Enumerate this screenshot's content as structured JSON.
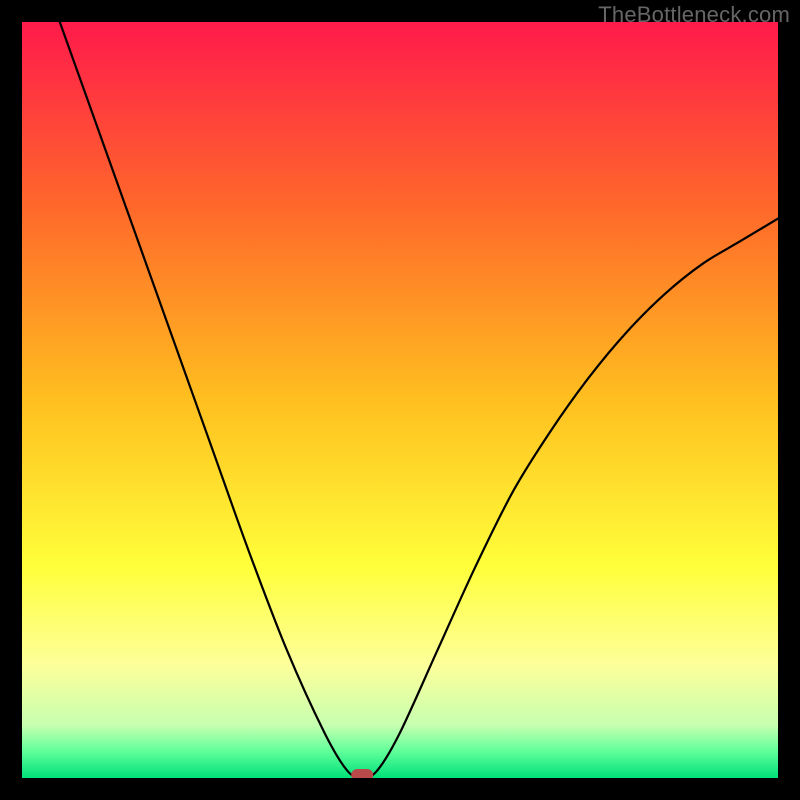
{
  "watermark": "TheBottleneck.com",
  "chart_data": {
    "type": "line",
    "title": "",
    "xlabel": "",
    "ylabel": "",
    "xlim": [
      0,
      100
    ],
    "ylim": [
      0,
      100
    ],
    "series": [
      {
        "name": "bottleneck-curve",
        "x": [
          5,
          10,
          15,
          20,
          25,
          30,
          35,
          40,
          43,
          45,
          47,
          50,
          55,
          60,
          65,
          70,
          75,
          80,
          85,
          90,
          95,
          100
        ],
        "y": [
          100,
          86,
          72,
          58,
          44,
          30,
          17,
          6,
          1,
          0,
          1,
          6,
          17,
          28,
          38,
          46,
          53,
          59,
          64,
          68,
          71,
          74
        ]
      }
    ],
    "marker": {
      "x": 45,
      "y": 0
    },
    "gradient_stops": [
      {
        "pos": 0.0,
        "color": "#ff1a4b"
      },
      {
        "pos": 0.25,
        "color": "#ff6a2a"
      },
      {
        "pos": 0.5,
        "color": "#ffbf1f"
      },
      {
        "pos": 0.72,
        "color": "#ffff3a"
      },
      {
        "pos": 0.85,
        "color": "#fdff9a"
      },
      {
        "pos": 0.93,
        "color": "#c7ffb0"
      },
      {
        "pos": 0.965,
        "color": "#5fff9a"
      },
      {
        "pos": 1.0,
        "color": "#00e07a"
      }
    ]
  }
}
